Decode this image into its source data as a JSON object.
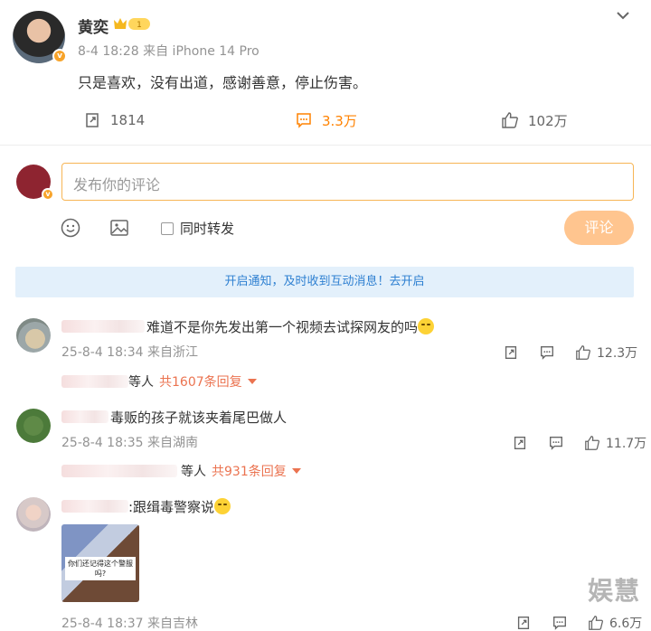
{
  "post": {
    "author": "黄奕",
    "level_badge": "1",
    "meta": "8-4 18:28 来自 iPhone 14 Pro",
    "text": "只是喜欢，没有出道，感谢善意，停止伤害。",
    "repost_count": "1814",
    "comment_count": "3.3万",
    "like_count": "102万"
  },
  "composer": {
    "placeholder": "发布你的评论",
    "sync_label": "同时转发",
    "submit_label": "评论"
  },
  "notice": "开启通知，及时收到互动消息！去开启",
  "comments": [
    {
      "text": "难道不是你先发出第一个视频去试探网友的吗",
      "meta": "25-8-4 18:34 来自浙江",
      "like_count": "12.3万",
      "reply_suffix": "等人",
      "reply_count": "共1607条回复"
    },
    {
      "text": "毒贩的孩子就该夹着尾巴做人",
      "meta": "25-8-4 18:35 来自湖南",
      "like_count": "11.7万",
      "reply_suffix": "等人",
      "reply_count": "共931条回复"
    },
    {
      "text": ":跟缉毒警察说",
      "image_caption": "你们还记得这个警服吗?",
      "meta": "25-8-4 18:37 来自吉林",
      "like_count": "6.6万"
    }
  ],
  "watermark": "娱慧",
  "colors": {
    "accent": "#ff8200",
    "notice_bg": "#e3f0fb",
    "notice_text": "#2d7fd1",
    "reply_link": "#eb7350"
  }
}
